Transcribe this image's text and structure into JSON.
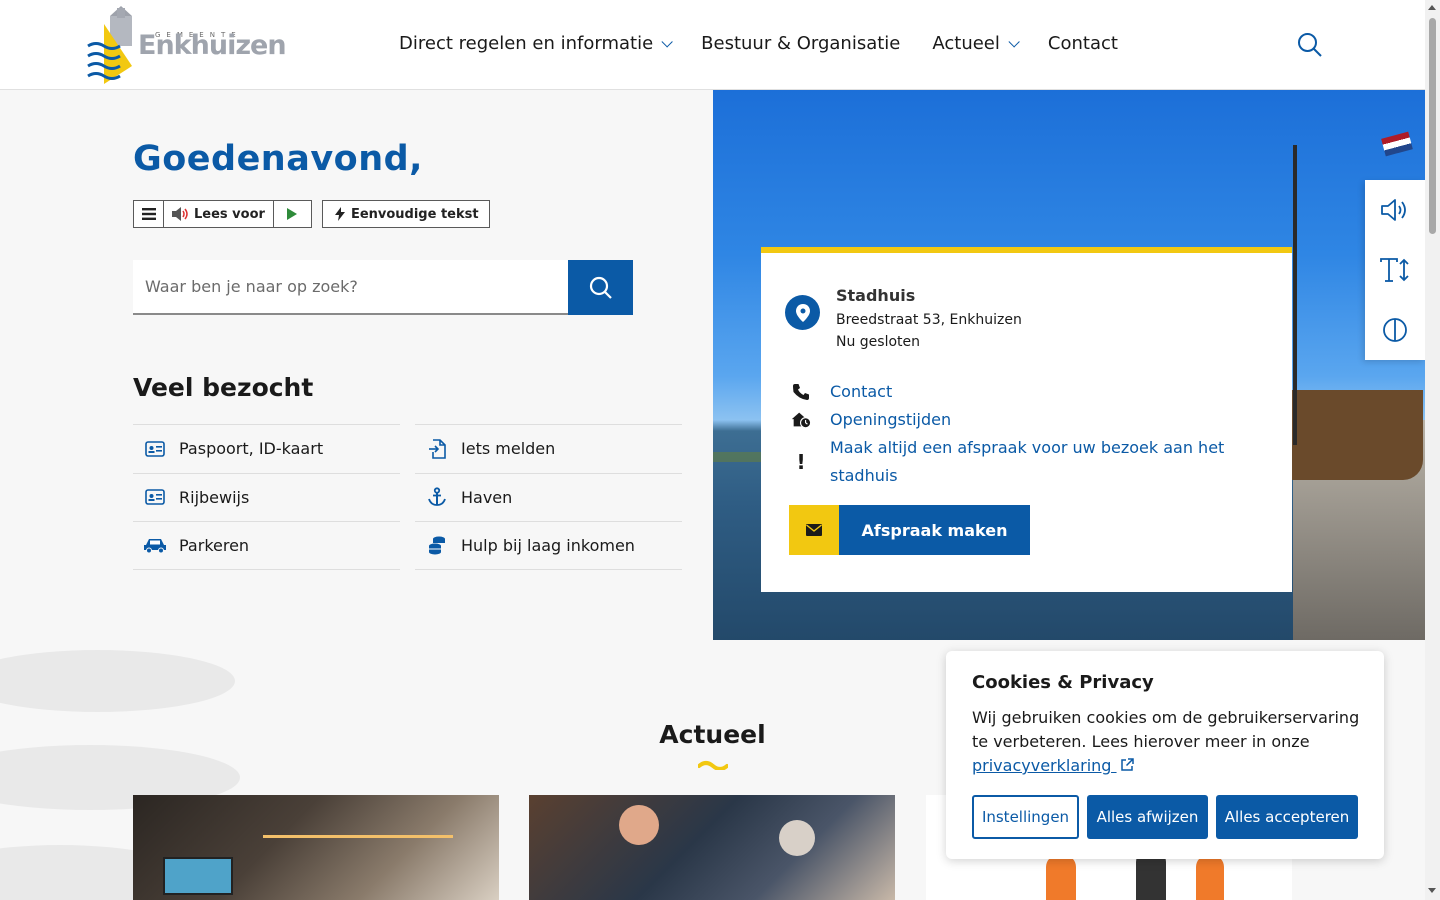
{
  "header": {
    "logo_sub": "GEMEENTE",
    "logo_main": "Enkhuizen",
    "nav": [
      {
        "label": "Direct regelen en informatie",
        "has_dropdown": true
      },
      {
        "label": "Bestuur & Organisatie",
        "has_dropdown": false
      },
      {
        "label": "Actueel",
        "has_dropdown": true
      },
      {
        "label": "Contact",
        "has_dropdown": false
      }
    ]
  },
  "hero": {
    "greeting": "Goedenavond,",
    "readspeaker": {
      "listen_label": "Lees voor",
      "simple_text_label": "Eenvoudige tekst"
    },
    "search": {
      "placeholder": "Waar ben je naar op zoek?"
    },
    "visited_title": "Veel bezocht",
    "visited_left": [
      {
        "label": "Paspoort, ID-kaart",
        "icon": "id-card-icon"
      },
      {
        "label": "Rijbewijs",
        "icon": "id-card-icon"
      },
      {
        "label": "Parkeren",
        "icon": "car-icon"
      }
    ],
    "visited_right": [
      {
        "label": "Iets melden",
        "icon": "file-report-icon"
      },
      {
        "label": "Haven",
        "icon": "anchor-icon"
      },
      {
        "label": "Hulp bij laag inkomen",
        "icon": "coins-icon"
      }
    ]
  },
  "info_card": {
    "title": "Stadhuis",
    "address": "Breedstraat 53, Enkhuizen",
    "status": "Nu gesloten",
    "links": [
      {
        "label": "Contact",
        "icon": "phone-icon"
      },
      {
        "label": "Openingstijden",
        "icon": "house-clock-icon"
      },
      {
        "label": "Maak altijd een afspraak voor uw bezoek aan het stadhuis",
        "icon": "exclamation-icon"
      }
    ],
    "appointment_label": "Afspraak maken"
  },
  "actueel": {
    "title": "Actueel"
  },
  "cookie": {
    "title": "Cookies & Privacy",
    "text": "Wij gebruiken cookies om de gebruikerservaring te verbeteren. Lees hierover meer in onze",
    "link": "privacyverklaring",
    "buttons": {
      "settings": "Instellingen",
      "reject": "Alles afwijzen",
      "accept": "Alles accepteren"
    }
  },
  "colors": {
    "primary": "#0b5aa6",
    "accent": "#f2c811",
    "background": "#f7f7f7"
  }
}
